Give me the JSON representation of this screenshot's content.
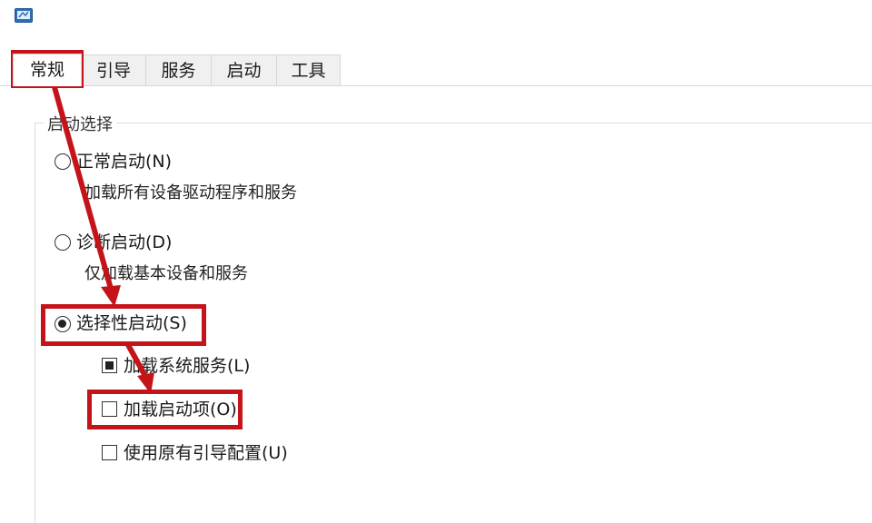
{
  "tabs": [
    {
      "label": "常规",
      "active": true
    },
    {
      "label": "引导",
      "active": false
    },
    {
      "label": "服务",
      "active": false
    },
    {
      "label": "启动",
      "active": false
    },
    {
      "label": "工具",
      "active": false
    }
  ],
  "startup_selection": {
    "group_title": "启动选择",
    "normal": {
      "label": "正常启动(N)",
      "description": "加载所有设备驱动程序和服务",
      "selected": false
    },
    "diagnostic": {
      "label": "诊断启动(D)",
      "description": "仅加载基本设备和服务",
      "selected": false
    },
    "selective": {
      "label": "选择性启动(S)",
      "selected": true
    },
    "options": [
      {
        "label": "加载系统服务(L)",
        "checked": true
      },
      {
        "label": "加载启动项(O)",
        "checked": false
      },
      {
        "label": "使用原有引导配置(U)",
        "checked": false
      }
    ]
  },
  "annotation": {
    "highlight_color": "#c4141a"
  }
}
